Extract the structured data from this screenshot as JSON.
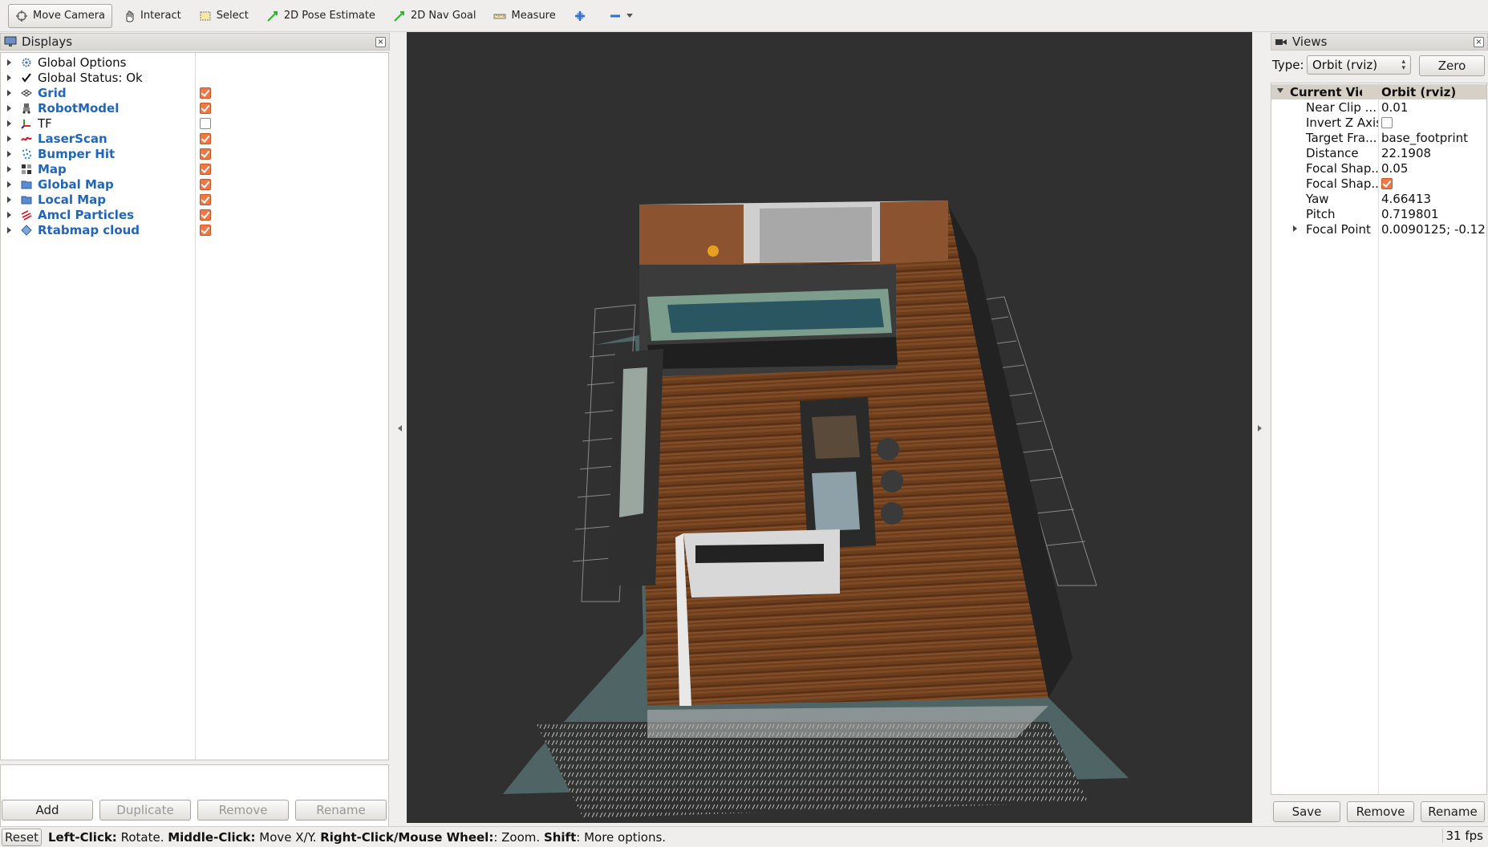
{
  "toolbar": {
    "tools": [
      {
        "label": "Move Camera",
        "icon": "move-camera-icon"
      },
      {
        "label": "Interact",
        "icon": "hand-icon"
      },
      {
        "label": "Select",
        "icon": "select-box-icon"
      },
      {
        "label": "2D Pose Estimate",
        "icon": "green-arrow-icon"
      },
      {
        "label": "2D Nav Goal",
        "icon": "green-arrow-icon"
      },
      {
        "label": "Measure",
        "icon": "ruler-icon"
      }
    ]
  },
  "displays": {
    "title": "Displays",
    "items": [
      {
        "label": "Global Options",
        "checked": null,
        "blue": false
      },
      {
        "label": "Global Status: Ok",
        "checked": null,
        "blue": false
      },
      {
        "label": "Grid",
        "checked": true,
        "blue": true
      },
      {
        "label": "RobotModel",
        "checked": true,
        "blue": true
      },
      {
        "label": "TF",
        "checked": false,
        "blue": false
      },
      {
        "label": "LaserScan",
        "checked": true,
        "blue": true
      },
      {
        "label": "Bumper Hit",
        "checked": true,
        "blue": true
      },
      {
        "label": "Map",
        "checked": true,
        "blue": true
      },
      {
        "label": "Global Map",
        "checked": true,
        "blue": true
      },
      {
        "label": "Local Map",
        "checked": true,
        "blue": true
      },
      {
        "label": "Amcl Particles",
        "checked": true,
        "blue": true
      },
      {
        "label": "Rtabmap cloud",
        "checked": true,
        "blue": true
      }
    ],
    "buttons": {
      "add": "Add",
      "duplicate": "Duplicate",
      "remove": "Remove",
      "rename": "Rename"
    }
  },
  "views": {
    "title": "Views",
    "type_label": "Type:",
    "type_value": "Orbit (rviz)",
    "zero_label": "Zero",
    "header": {
      "name": "Current View",
      "value": "Orbit (rviz)"
    },
    "props": [
      {
        "name": "Near Clip ...",
        "value": "0.01"
      },
      {
        "name": "Invert Z Axis",
        "value": ""
      },
      {
        "name": "Target Fra...",
        "value": "base_footprint"
      },
      {
        "name": "Distance",
        "value": "22.1908"
      },
      {
        "name": "Focal Shap...",
        "value": "0.05"
      },
      {
        "name": "Focal Shap...",
        "value": ""
      },
      {
        "name": "Yaw",
        "value": "4.66413"
      },
      {
        "name": "Pitch",
        "value": "0.719801"
      },
      {
        "name": "Focal Point",
        "value": "0.0090125; -0.12..."
      }
    ],
    "invert_z_checked": false,
    "focal_fixed_checked": true,
    "buttons": {
      "save": "Save",
      "remove": "Remove",
      "rename": "Rename"
    }
  },
  "status": {
    "reset": "Reset",
    "k1": "Left-Click:",
    "v1": " Rotate. ",
    "k2": "Middle-Click:",
    "v2": " Move X/Y. ",
    "k3": "Right-Click/Mouse Wheel:",
    "v3": ": Zoom. ",
    "k4": "Shift",
    "v4": ": More options.",
    "fps": "31 fps"
  },
  "colors": {
    "accent_blue": "#2266bb",
    "checkbox_orange": "#f07746",
    "viewport_bg": "#303030"
  }
}
